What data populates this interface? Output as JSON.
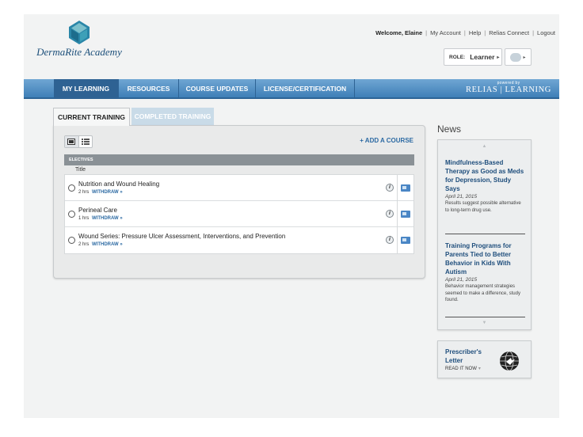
{
  "header": {
    "logo_text": "DermaRite Academy",
    "welcome": "Welcome, Elaine",
    "links": [
      "My Account",
      "Help",
      "Relias Connect",
      "Logout"
    ],
    "role_label": "ROLE:",
    "role_value": "Learner"
  },
  "nav": {
    "items": [
      "MY LEARNING",
      "RESOURCES",
      "COURSE UPDATES",
      "LICENSE/CERTIFICATION"
    ],
    "active": "MY LEARNING",
    "powered_by": "powered by",
    "brand": "RELIAS | LEARNING"
  },
  "tabs": {
    "current": "CURRENT TRAINING",
    "completed": "COMPLETED TRAINING"
  },
  "training": {
    "add_course": "+ ADD A COURSE",
    "section": "ELECTIVES",
    "column_title": "Title",
    "courses": [
      {
        "title": "Nutrition and Wound Healing",
        "duration": "2 hrs",
        "action": "WITHDRAW »"
      },
      {
        "title": "Perineal Care",
        "duration": "1 hrs",
        "action": "WITHDRAW »"
      },
      {
        "title": "Wound Series:  Pressure Ulcer Assessment, Interventions, and Prevention",
        "duration": "2 hrs",
        "action": "WITHDRAW »"
      }
    ]
  },
  "news": {
    "heading": "News",
    "items": [
      {
        "title": "Mindfulness-Based Therapy as Good as Meds for Depression, Study Says",
        "date": "April 21, 2015",
        "summary": "Results suggest possible alternative to long-term drug use."
      },
      {
        "title": "Training Programs for Parents Tied to Better Behavior in Kids With Autism",
        "date": "April 21, 2015",
        "summary": "Behavior management strategies seemed to make a difference, study found."
      }
    ]
  },
  "prescriber": {
    "title": "Prescriber's Letter",
    "link": "READ IT NOW"
  },
  "colors": {
    "nav": "#3f7fb7",
    "nav_active": "#2e6293",
    "link": "#2c6aa3",
    "news_title": "#204f7d"
  }
}
